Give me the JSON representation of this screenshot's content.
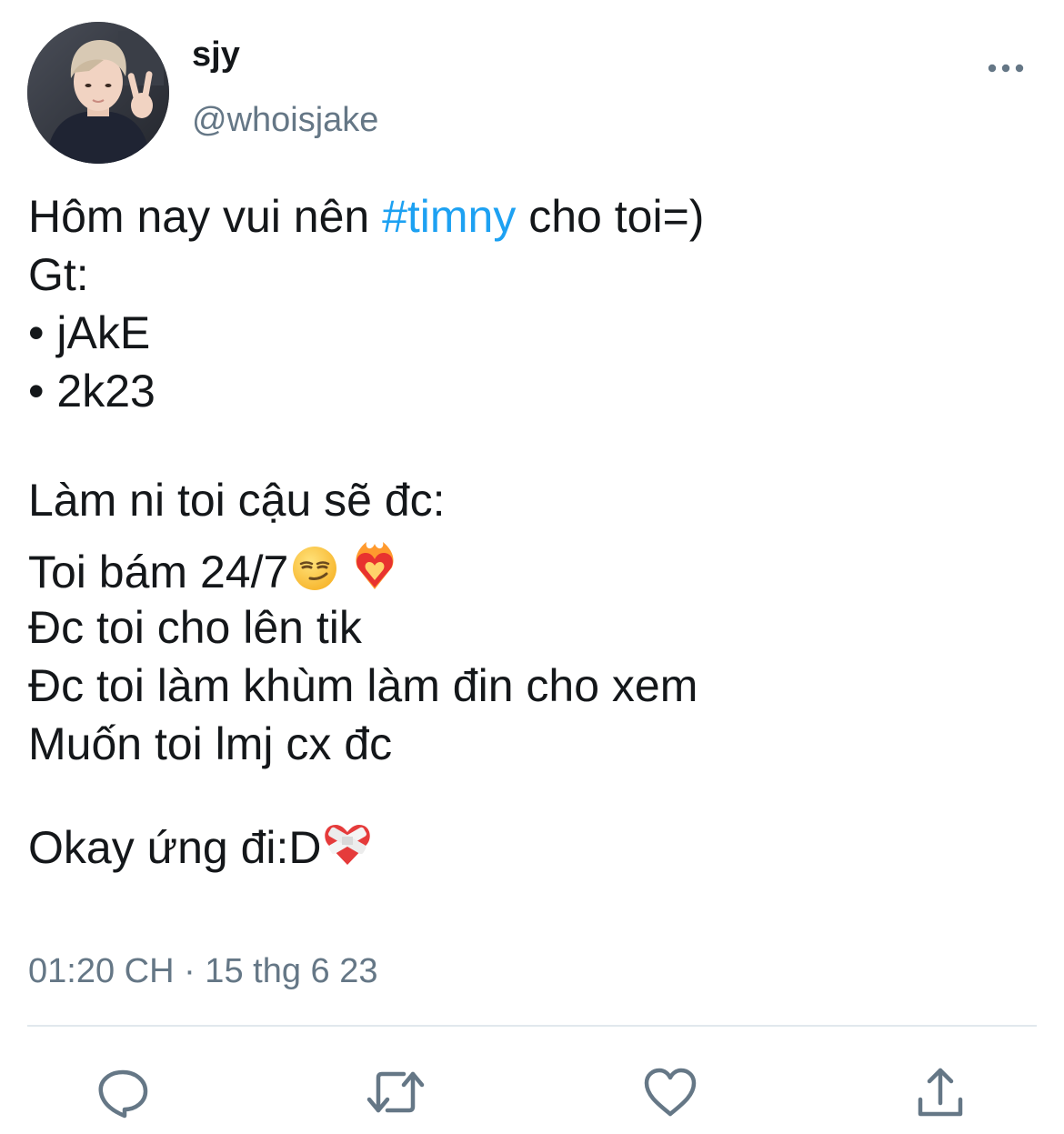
{
  "user": {
    "display_name": "sjy",
    "handle": "@whoisjake"
  },
  "tweet": {
    "line1_before": "Hôm nay vui nên ",
    "hashtag": "#timny",
    "line1_after": " cho toi=)",
    "line2": "Gt:",
    "line3": "• jAkE",
    "line4": "• 2k23",
    "line5": "Làm ni toi cậu sẽ đc:",
    "line6": "Toi bám 24/7",
    "line7": "Đc toi cho lên tik",
    "line8": "Đc toi làm khùm làm đin cho xem",
    "line9": "Muốn toi lmj cx đc",
    "line10": "Okay ứng đi:D",
    "emojis": [
      "smirking-face",
      "heart-on-fire",
      "mending-heart"
    ]
  },
  "meta": {
    "timestamp": "01:20 CH · 15 thg 6 23"
  },
  "actions": [
    "reply-icon",
    "retweet-icon",
    "like-icon",
    "share-icon"
  ],
  "colors": {
    "text": "#14171a",
    "secondary": "#657786",
    "hashtag": "#1da1f2",
    "divider": "#e1e8ed"
  }
}
